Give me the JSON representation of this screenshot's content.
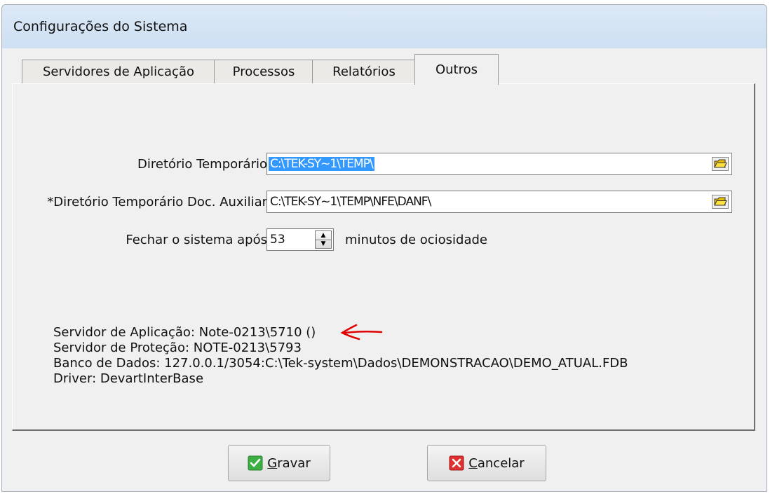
{
  "window": {
    "title": "Configurações do Sistema"
  },
  "tabs": [
    {
      "label": "Servidores de Aplicação"
    },
    {
      "label": "Processos"
    },
    {
      "label": "Relatórios"
    },
    {
      "label": "Outros"
    }
  ],
  "form": {
    "temp_dir_label": "Diretório Temporário",
    "temp_dir_value": "C:\\TEK-SY~1\\TEMP\\",
    "temp_aux_label": "*Diretório Temporário Doc. Auxiliar",
    "temp_aux_value": "C:\\TEK-SY~1\\TEMP\\NFE\\DANF\\",
    "close_label": "Fechar o sistema após",
    "close_value": "53",
    "close_suffix": "minutos de ociosidade"
  },
  "info": {
    "app_server": "Servidor de Aplicação: Note-0213\\5710 ()",
    "protection_server": "Servidor de Proteção: NOTE-0213\\5793",
    "database": "Banco de Dados: 127.0.0.1/3054:C:\\Tek-system\\Dados\\DEMONSTRACAO\\DEMO_ATUAL.FDB",
    "driver": "Driver: DevartInterBase"
  },
  "buttons": {
    "save_first": "G",
    "save_rest": "ravar",
    "cancel_first": "C",
    "cancel_rest": "ancelar"
  },
  "colors": {
    "selection": "#3399ff",
    "annotation_arrow": "#e00000",
    "save_icon": "#3cb043",
    "cancel_icon": "#e03030",
    "folder_icon": "#e8c000"
  }
}
